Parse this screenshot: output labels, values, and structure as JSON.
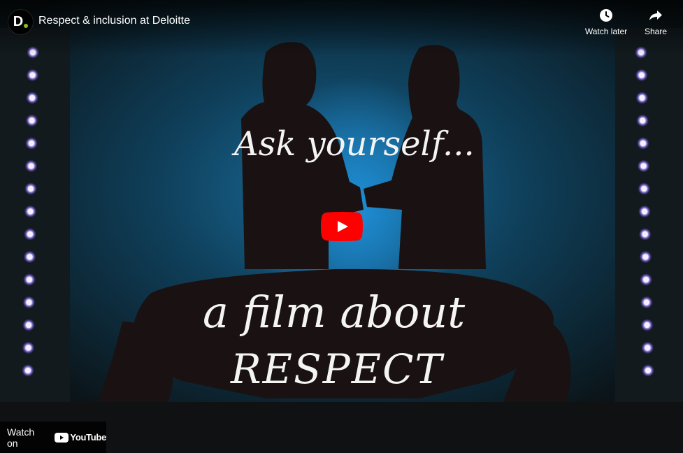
{
  "player": {
    "title": "Respect & inclusion at Deloitte",
    "channel_logo_letter": "D",
    "brand_color": "#86bc25",
    "actions": [
      {
        "label": "Watch later",
        "icon": "clock-icon"
      },
      {
        "label": "Share",
        "icon": "share-arrow-icon"
      }
    ],
    "play_button": {
      "icon": "play-icon",
      "color": "#ff0000"
    },
    "watch_on": {
      "label": "Watch on",
      "brand": "YouTube"
    }
  },
  "thumbnail": {
    "line1": "Ask yourself...",
    "line2": "a film about",
    "line3": "RESPECT"
  }
}
